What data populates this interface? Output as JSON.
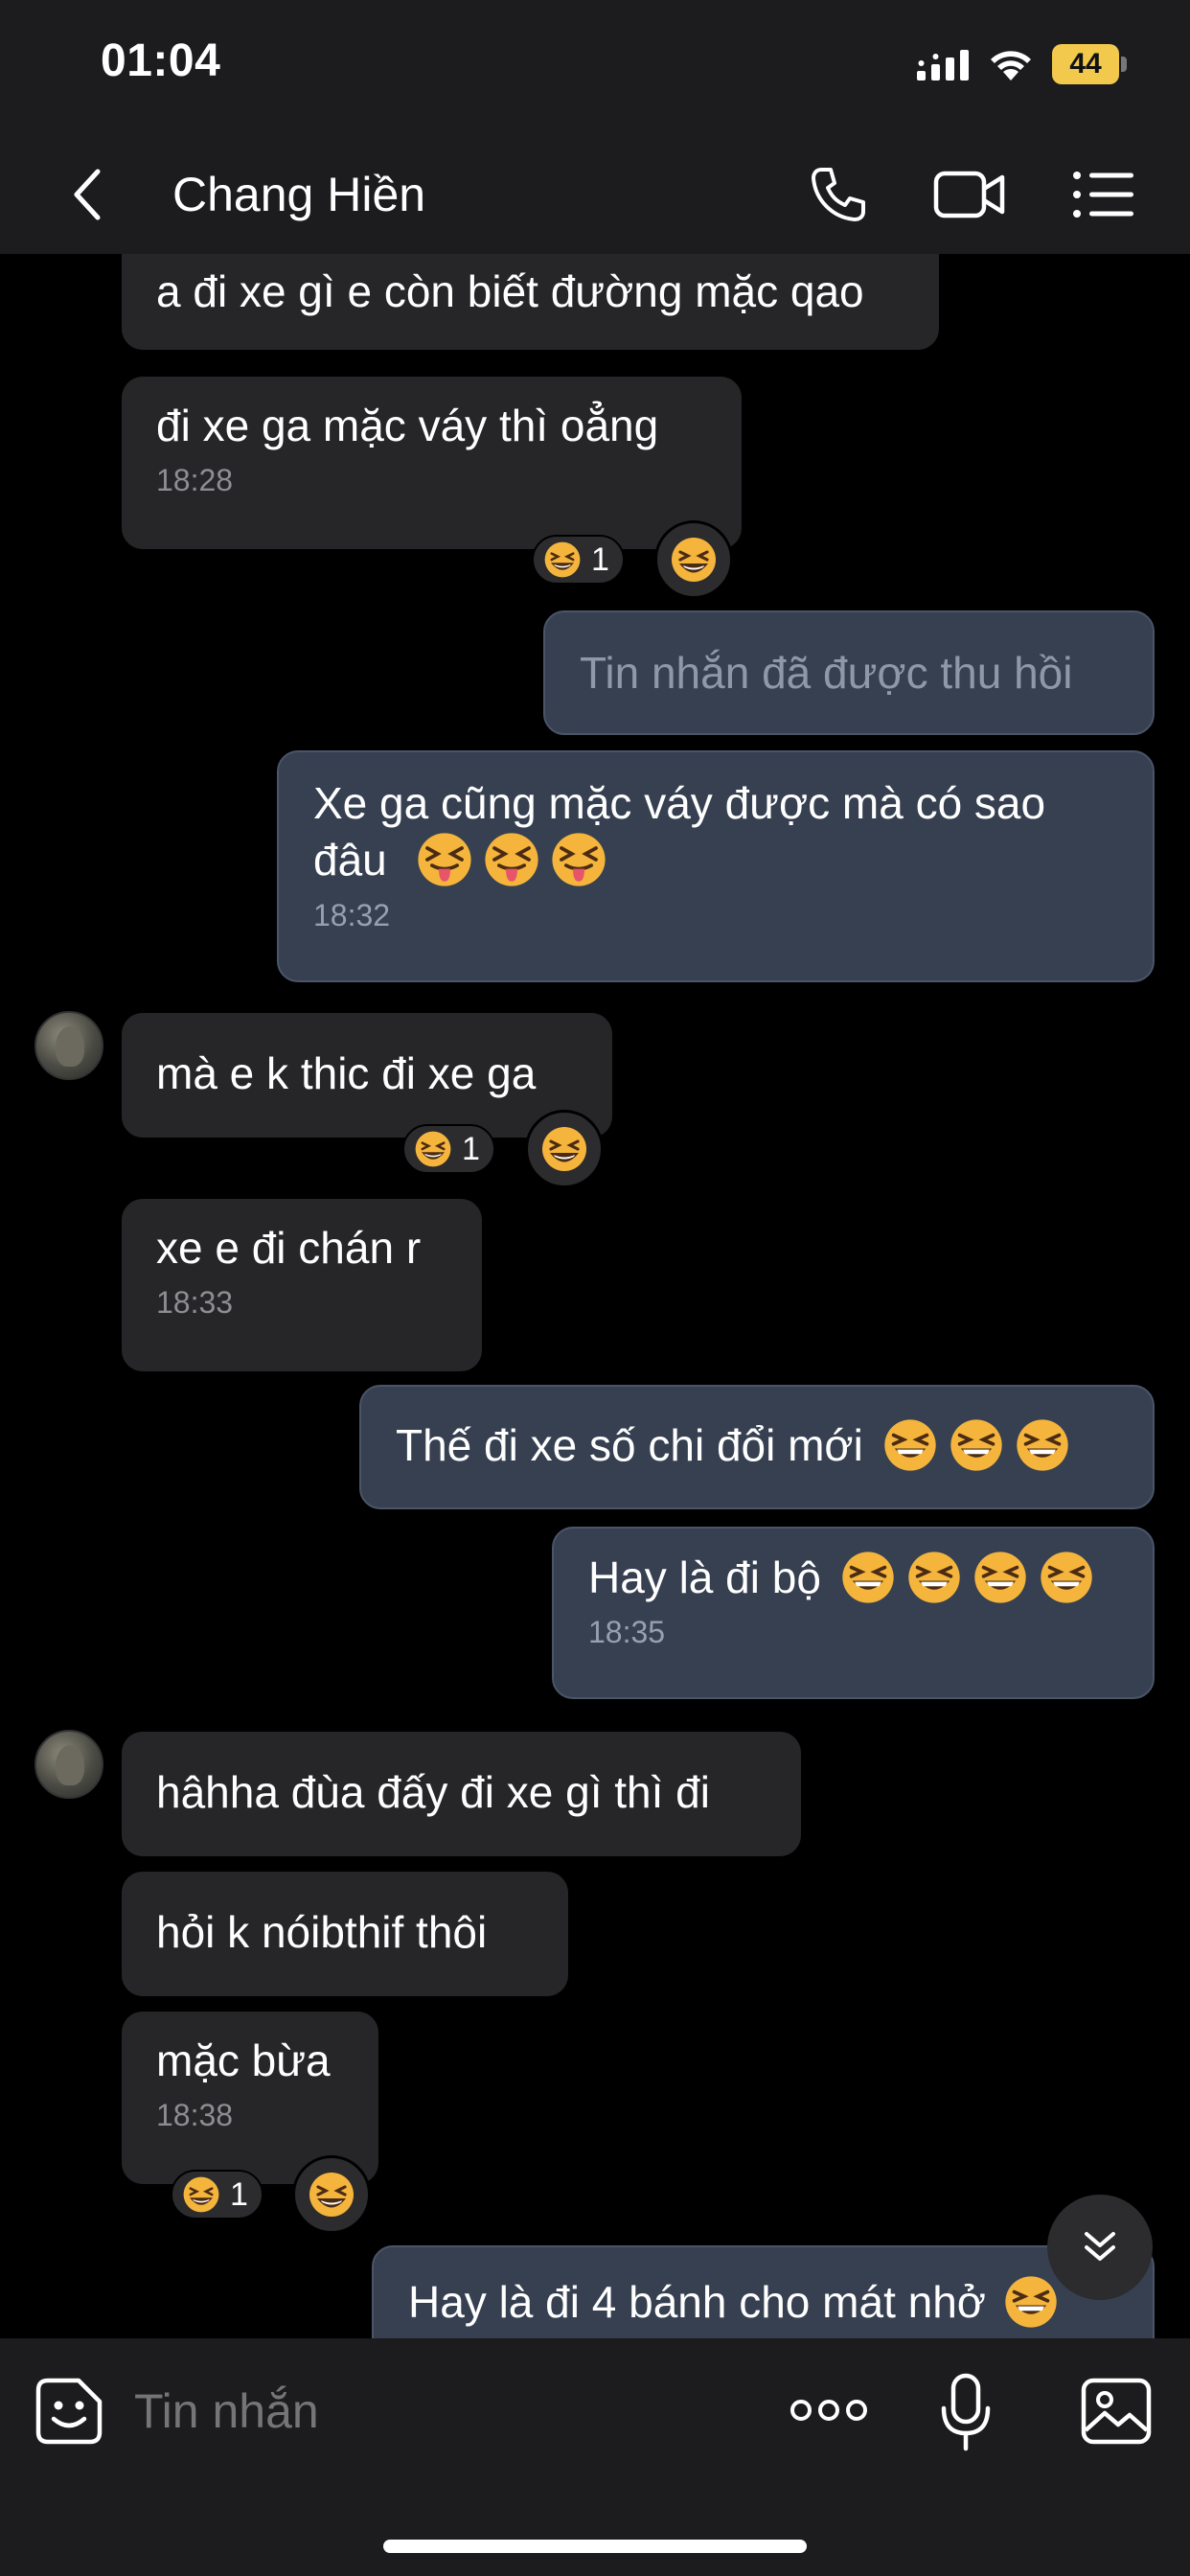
{
  "status_bar": {
    "time": "01:04",
    "battery": "44"
  },
  "header": {
    "contact_name": "Chang Hiền"
  },
  "messages": [
    {
      "text": "a đi xe gì e còn biết đường mặc qao",
      "time": ""
    },
    {
      "text": "đi xe ga mặc váy thì oẳng",
      "time": "18:28",
      "reaction_count": "1"
    },
    {
      "text": "Tin nhắn đã được thu hồi"
    },
    {
      "line1": "Xe ga cũng mặc váy được mà có sao",
      "line2": "đâu",
      "time": "18:32"
    },
    {
      "text": "mà e k thic đi xe ga",
      "reaction_count": "1"
    },
    {
      "text": "xe e đi chán r",
      "time": "18:33"
    },
    {
      "text": "Thế đi xe số chi đổi mới"
    },
    {
      "text": "Hay là đi bộ",
      "time": "18:35"
    },
    {
      "text": "hâhha đùa đấy đi xe gì thì đi"
    },
    {
      "text": "hỏi k nóibthif thôi"
    },
    {
      "text": "mặc bừa",
      "time": "18:38",
      "reaction_count": "1"
    },
    {
      "text": "Hay là đi 4 bánh cho mát nhở"
    }
  ],
  "input": {
    "placeholder": "Tin nhắn"
  },
  "icons": {
    "back": "chevron-left-icon",
    "call": "phone-icon",
    "video": "video-camera-icon",
    "menu": "list-icon",
    "sticker": "sticker-smile-icon",
    "more": "more-dots-icon",
    "mic": "microphone-icon",
    "image": "image-icon",
    "scroll": "double-chevron-down-icon"
  },
  "colors": {
    "background": "#000000",
    "bar": "#1c1c1e",
    "incoming_bubble": "#262628",
    "outgoing_bubble": "#364051",
    "battery": "#f2c94c"
  }
}
